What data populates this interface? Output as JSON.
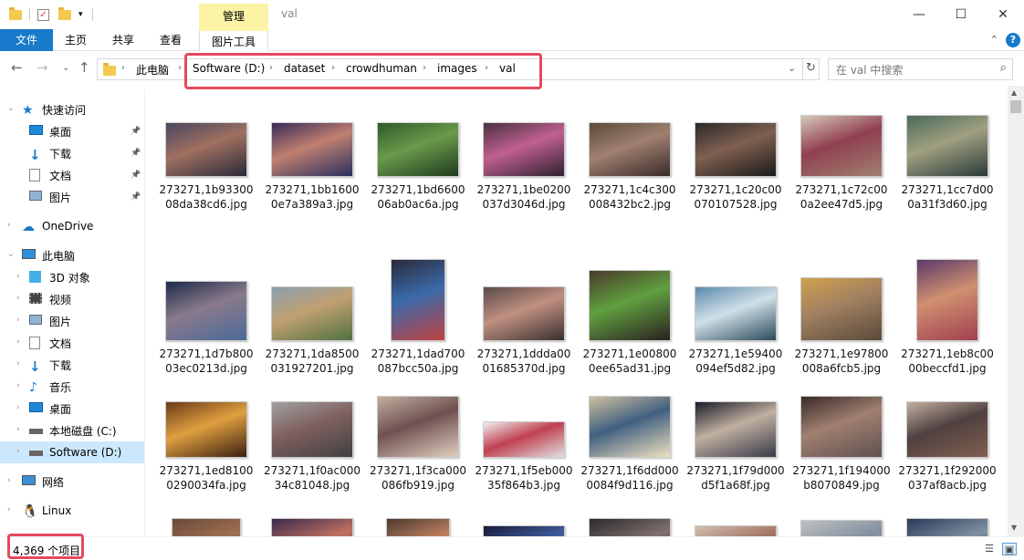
{
  "window": {
    "title": "val",
    "context_tab": "管理",
    "minimize": "—",
    "maximize": "☐",
    "close": "✕"
  },
  "ribbon": {
    "tabs": [
      "文件",
      "主页",
      "共享",
      "查看",
      "图片工具"
    ],
    "help": "?"
  },
  "address": {
    "root_crumb": "此电脑",
    "crumbs": [
      "Software (D:)",
      "dataset",
      "crowdhuman",
      "images",
      "val"
    ],
    "search_placeholder": "在 val 中搜索"
  },
  "sidebar": {
    "items": [
      {
        "label": "快速访问",
        "icon": "star-icon",
        "level": 0
      },
      {
        "label": "桌面",
        "icon": "desktop-icon",
        "level": 1,
        "pinned": true
      },
      {
        "label": "下载",
        "icon": "download-icon",
        "level": 1,
        "pinned": true
      },
      {
        "label": "文档",
        "icon": "document-icon",
        "level": 1,
        "pinned": true
      },
      {
        "label": "图片",
        "icon": "picture-icon",
        "level": 1,
        "pinned": true
      },
      {
        "label": "OneDrive",
        "icon": "cloud-icon",
        "level": 0
      },
      {
        "label": "此电脑",
        "icon": "computer-icon",
        "level": 0
      },
      {
        "label": "3D 对象",
        "icon": "cube-icon",
        "level": 1
      },
      {
        "label": "视频",
        "icon": "video-icon",
        "level": 1
      },
      {
        "label": "图片",
        "icon": "picture-icon",
        "level": 1
      },
      {
        "label": "文档",
        "icon": "document-icon",
        "level": 1
      },
      {
        "label": "下载",
        "icon": "download-icon",
        "level": 1
      },
      {
        "label": "音乐",
        "icon": "music-icon",
        "level": 1
      },
      {
        "label": "桌面",
        "icon": "desktop-icon",
        "level": 1
      },
      {
        "label": "本地磁盘 (C:)",
        "icon": "drive-icon",
        "level": 1
      },
      {
        "label": "Software (D:)",
        "icon": "drive-icon",
        "level": 1,
        "selected": true
      },
      {
        "label": "网络",
        "icon": "network-icon",
        "level": 0
      },
      {
        "label": "Linux",
        "icon": "linux-icon",
        "level": 0
      }
    ]
  },
  "files": [
    {
      "name": "273271,1b9330008da38cd6.jpg",
      "colors": [
        "#4a4560",
        "#a07060",
        "#2a2a3a"
      ]
    },
    {
      "name": "273271,1bb16000e7a389a3.jpg",
      "colors": [
        "#3a2a5a",
        "#c08070",
        "#2a3060"
      ]
    },
    {
      "name": "273271,1bd660006ab0ac6a.jpg",
      "colors": [
        "#2e5a2a",
        "#6a9a4a",
        "#1e3a1e"
      ]
    },
    {
      "name": "273271,1be0200037d3046d.jpg",
      "colors": [
        "#4a3040",
        "#c06090",
        "#302030"
      ]
    },
    {
      "name": "273271,1c4c300008432bc2.jpg",
      "colors": [
        "#5a4a3a",
        "#a08070",
        "#3a2a2a"
      ]
    },
    {
      "name": "273271,1c20c00070107528.jpg",
      "colors": [
        "#2a2a2a",
        "#806050",
        "#1a1a1a"
      ]
    },
    {
      "name": "273271,1c72c000a2ee47d5.jpg",
      "colors": [
        "#d8c8b8",
        "#904050",
        "#a08070"
      ]
    },
    {
      "name": "273271,1cc7d000a31f3d60.jpg",
      "colors": [
        "#4a6a5a",
        "#a0a080",
        "#2a3a3a"
      ]
    },
    {
      "name": "273271,1d7b80003ec0213d.jpg",
      "colors": [
        "#1a2a4a",
        "#8a7a8a",
        "#4a6a9a"
      ]
    },
    {
      "name": "273271,1da8500031927201.jpg",
      "colors": [
        "#8aa0b0",
        "#c0a070",
        "#507040"
      ]
    },
    {
      "name": "273271,1dad700087bcc50a.jpg",
      "colors": [
        "#2a2a3a",
        "#3a6aaa",
        "#c04040"
      ]
    },
    {
      "name": "273271,1ddda0001685370d.jpg",
      "colors": [
        "#5a4a4a",
        "#c09080",
        "#3a3030"
      ]
    },
    {
      "name": "273271,1e008000ee65ad31.jpg",
      "colors": [
        "#4a3a2a",
        "#60a040",
        "#2a2020"
      ]
    },
    {
      "name": "273271,1e59400094ef5d82.jpg",
      "colors": [
        "#5a8aaa",
        "#d0e0e8",
        "#2a4a5a"
      ]
    },
    {
      "name": "273271,1e97800008a6fcb5.jpg",
      "colors": [
        "#d0a050",
        "#a08060",
        "#5a4a3a"
      ]
    },
    {
      "name": "273271,1eb8c0000beccfd1.jpg",
      "colors": [
        "#5a3a6a",
        "#d09070",
        "#a04050"
      ]
    },
    {
      "name": "273271,1ed81000290034fa.jpg",
      "colors": [
        "#6a3a1a",
        "#e0a040",
        "#3a2010"
      ]
    },
    {
      "name": "273271,1f0ac00034c81048.jpg",
      "colors": [
        "#a0a0a0",
        "#806060",
        "#404040"
      ]
    },
    {
      "name": "273271,1f3ca000086fb919.jpg",
      "colors": [
        "#c0b0a0",
        "#705050",
        "#e0d0c0"
      ]
    },
    {
      "name": "273271,1f5eb00035f864b3.jpg",
      "colors": [
        "#f0f0f0",
        "#c04050",
        "#e0e0e0"
      ]
    },
    {
      "name": "273271,1f6dd0000084f9d116.jpg",
      "colors": [
        "#d0c0a0",
        "#406080",
        "#f0e0c0"
      ]
    },
    {
      "name": "273271,1f79d000d5f1a68f.jpg",
      "colors": [
        "#1a1a2a",
        "#c0b0a0",
        "#3a3a4a"
      ]
    },
    {
      "name": "273271,1f194000b8070849.jpg",
      "colors": [
        "#3a2a2a",
        "#a08070",
        "#605050"
      ]
    },
    {
      "name": "273271,1f292000037af8acb.jpg",
      "colors": [
        "#c0b0a0",
        "#504040",
        "#806050"
      ]
    },
    {
      "name": "",
      "colors": [
        "#6a4a3a",
        "#a07050",
        "#3a2a20"
      ]
    },
    {
      "name": "",
      "colors": [
        "#3a2a4a",
        "#c07060",
        "#2a2030"
      ]
    },
    {
      "name": "",
      "colors": [
        "#4a3a30",
        "#c08060",
        "#2a2020"
      ]
    },
    {
      "name": "",
      "colors": [
        "#1a1a3a",
        "#4060a0",
        "#101020"
      ]
    },
    {
      "name": "",
      "colors": [
        "#2a2a2a",
        "#807070",
        "#1a1a1a"
      ]
    },
    {
      "name": "",
      "colors": [
        "#d0c0b0",
        "#a07060",
        "#f0e0d0"
      ]
    },
    {
      "name": "",
      "colors": [
        "#c0c0c0",
        "#8090a0",
        "#e0e0e0"
      ]
    },
    {
      "name": "",
      "colors": [
        "#2a3a5a",
        "#8090a0",
        "#1a2a3a"
      ]
    }
  ],
  "status": {
    "count": "4,369 个项目"
  },
  "colors": {
    "accent": "#1979ca",
    "selection": "#cce8ff",
    "highlight": "#e5495c",
    "context_tab": "#fdf3a6"
  }
}
